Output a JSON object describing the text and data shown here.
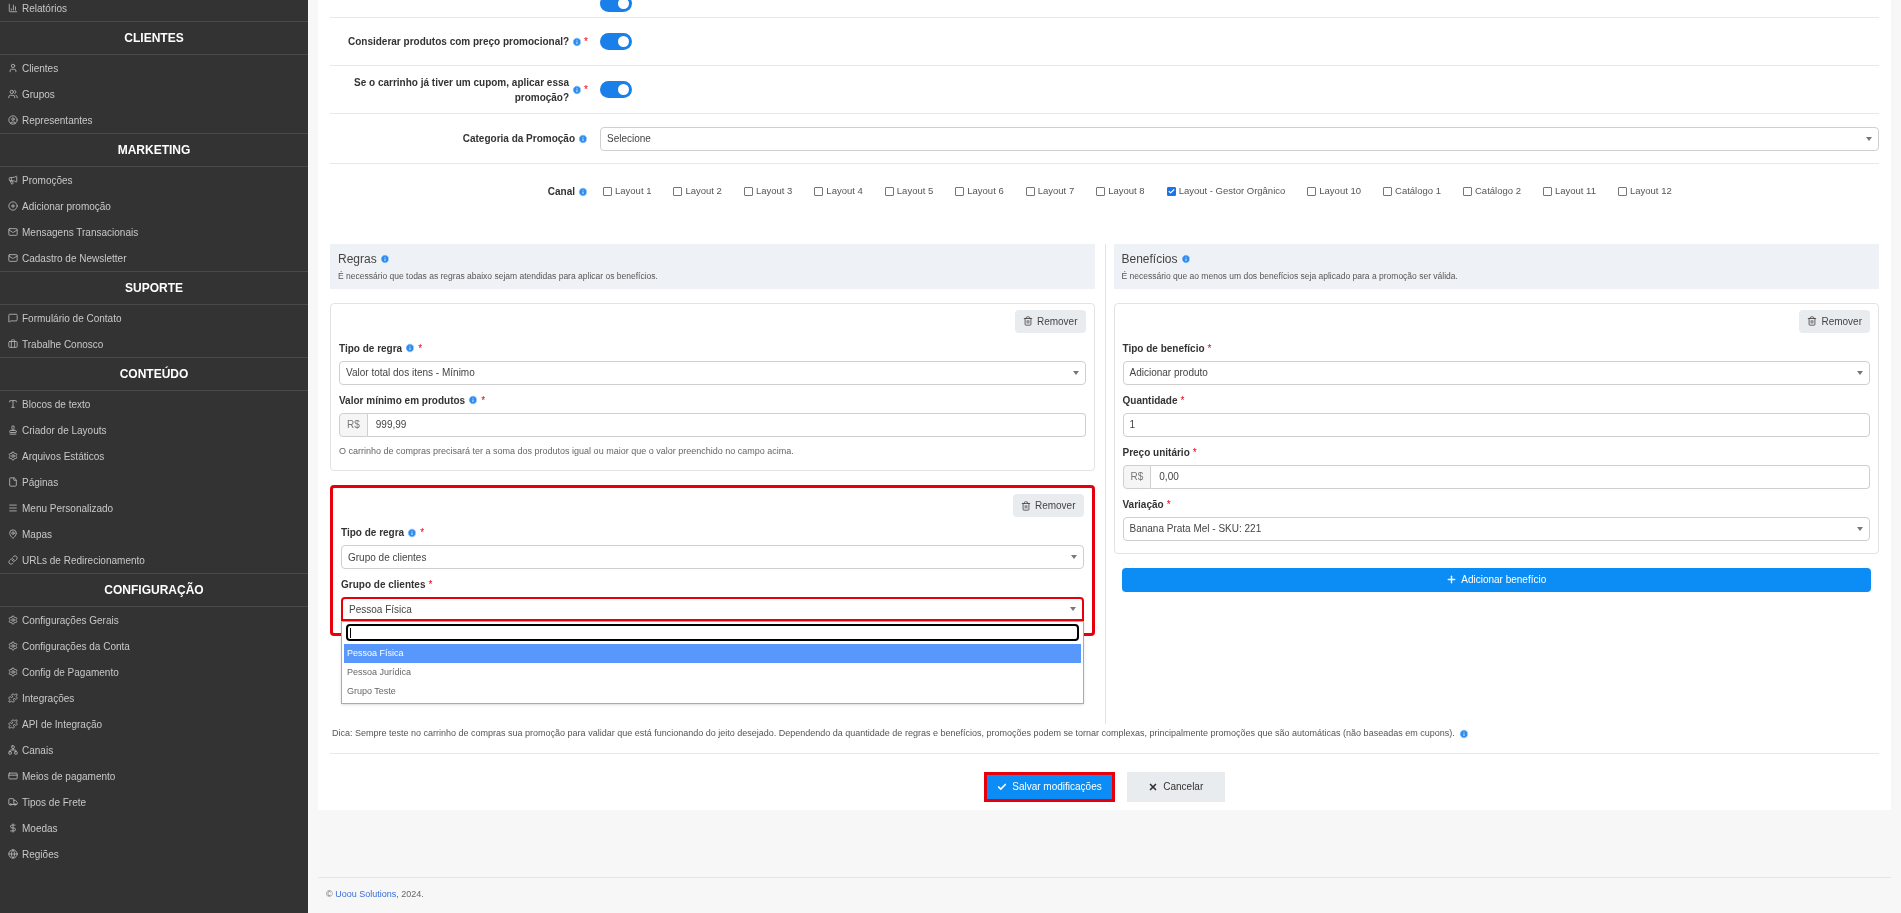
{
  "sidebar": {
    "sections": [
      {
        "items": [
          {
            "label": "Relatórios"
          }
        ]
      },
      {
        "title": "CLIENTES",
        "items": [
          {
            "label": "Clientes"
          },
          {
            "label": "Grupos"
          },
          {
            "label": "Representantes"
          }
        ]
      },
      {
        "title": "MARKETING",
        "items": [
          {
            "label": "Promoções"
          },
          {
            "label": "Adicionar promoção"
          },
          {
            "label": "Mensagens Transacionais"
          },
          {
            "label": "Cadastro de Newsletter"
          }
        ]
      },
      {
        "title": "SUPORTE",
        "items": [
          {
            "label": "Formulário de Contato"
          },
          {
            "label": "Trabalhe Conosco"
          }
        ]
      },
      {
        "title": "CONTEÚDO",
        "items": [
          {
            "label": "Blocos de texto"
          },
          {
            "label": "Criador de Layouts"
          },
          {
            "label": "Arquivos Estáticos"
          },
          {
            "label": "Páginas"
          },
          {
            "label": "Menu Personalizado"
          },
          {
            "label": "Mapas"
          },
          {
            "label": "URLs de Redirecionamento"
          }
        ]
      },
      {
        "title": "CONFIGURAÇÃO",
        "items": [
          {
            "label": "Configurações Gerais"
          },
          {
            "label": "Configurações da Conta"
          },
          {
            "label": "Config de Pagamento"
          },
          {
            "label": "Integrações"
          },
          {
            "label": "API de Integração"
          },
          {
            "label": "Canais"
          },
          {
            "label": "Meios de pagamento"
          },
          {
            "label": "Tipos de Frete"
          },
          {
            "label": "Moedas"
          },
          {
            "label": "Regiões"
          }
        ]
      }
    ]
  },
  "form": {
    "toggles": [
      {
        "on": true
      },
      {
        "label": "Considerar produtos com preço promocional?",
        "info": true,
        "required": "*",
        "on": true
      },
      {
        "label": "Se o carrinho já tiver um cupom, aplicar essa promoção?",
        "info": true,
        "required": "*",
        "on": true
      }
    ],
    "category": {
      "label": "Categoria da Promoção",
      "value": "Selecione"
    },
    "channel": {
      "label": "Canal",
      "options": [
        {
          "label": "Layout 1",
          "checked": false
        },
        {
          "label": "Layout 2",
          "checked": false
        },
        {
          "label": "Layout 3",
          "checked": false
        },
        {
          "label": "Layout 4",
          "checked": false
        },
        {
          "label": "Layout 5",
          "checked": false
        },
        {
          "label": "Layout 6",
          "checked": false
        },
        {
          "label": "Layout 7",
          "checked": false
        },
        {
          "label": "Layout 8",
          "checked": false
        },
        {
          "label": "Layout - Gestor Orgânico",
          "checked": true
        },
        {
          "label": "Layout 10",
          "checked": false
        },
        {
          "label": "Catálogo 1",
          "checked": false
        },
        {
          "label": "Catálogo 2",
          "checked": false
        },
        {
          "label": "Layout 11",
          "checked": false
        },
        {
          "label": "Layout 12",
          "checked": false
        }
      ]
    }
  },
  "rules": {
    "title": "Regras",
    "description": "É necessário que todas as regras abaixo sejam atendidas para aplicar os benefícios.",
    "cards": [
      {
        "highlighted": false,
        "remove": "Remover",
        "fields": [
          {
            "kind": "select",
            "label": "Tipo de regra",
            "info": true,
            "required": "*",
            "value": "Valor total dos itens - Mínimo"
          },
          {
            "kind": "money",
            "label": "Valor mínimo em produtos",
            "info": true,
            "required": "*",
            "prefix": "R$",
            "value": "999,99",
            "help": "O carrinho de compras precisará ter a soma dos produtos igual ou maior que o valor preenchido no campo acima."
          }
        ]
      },
      {
        "highlighted": true,
        "remove": "Remover",
        "fields": [
          {
            "kind": "select",
            "label": "Tipo de regra",
            "info": true,
            "required": "*",
            "value": "Grupo de clientes"
          },
          {
            "kind": "select",
            "label": "Grupo de clientes",
            "info": false,
            "required": "*",
            "value": "Pessoa Física",
            "highlighted": true,
            "open": true,
            "options": [
              {
                "label": "Pessoa Física",
                "selected": true
              },
              {
                "label": "Pessoa Jurídica",
                "selected": false
              },
              {
                "label": "Grupo Teste",
                "selected": false
              }
            ]
          }
        ]
      }
    ]
  },
  "benefits": {
    "title": "Benefícios",
    "description": "É necessário que ao menos um dos benefícios seja aplicado para a promoção ser válida.",
    "cards": [
      {
        "highlighted": false,
        "remove": "Remover",
        "fields": [
          {
            "kind": "select",
            "label": "Tipo de benefício",
            "info": false,
            "required": "*",
            "value": "Adicionar produto"
          },
          {
            "kind": "text",
            "label": "Quantidade",
            "info": false,
            "required": "*",
            "value": "1"
          },
          {
            "kind": "money",
            "label": "Preço unitário",
            "info": false,
            "required": "*",
            "prefix": "R$",
            "value": "0,00"
          },
          {
            "kind": "select",
            "label": "Variação",
            "info": false,
            "required": "*",
            "value": "Banana Prata Mel - SKU: 221"
          }
        ]
      }
    ],
    "add_button": "Adicionar benefício"
  },
  "tip": "Dica: Sempre teste no carrinho de compras sua promoção para validar que está funcionando do jeito desejado. Dependendo da quantidade de regras e benefícios, promoções podem se tornar complexas, principalmente promoções que são automáticas (não baseadas em cupons).",
  "actions": {
    "save": {
      "label": "Salvar modificações",
      "highlighted": true
    },
    "cancel": {
      "label": "Cancelar"
    }
  },
  "footer": {
    "prefix": "© ",
    "link": "Uoou Solutions",
    "suffix": ", 2024."
  }
}
